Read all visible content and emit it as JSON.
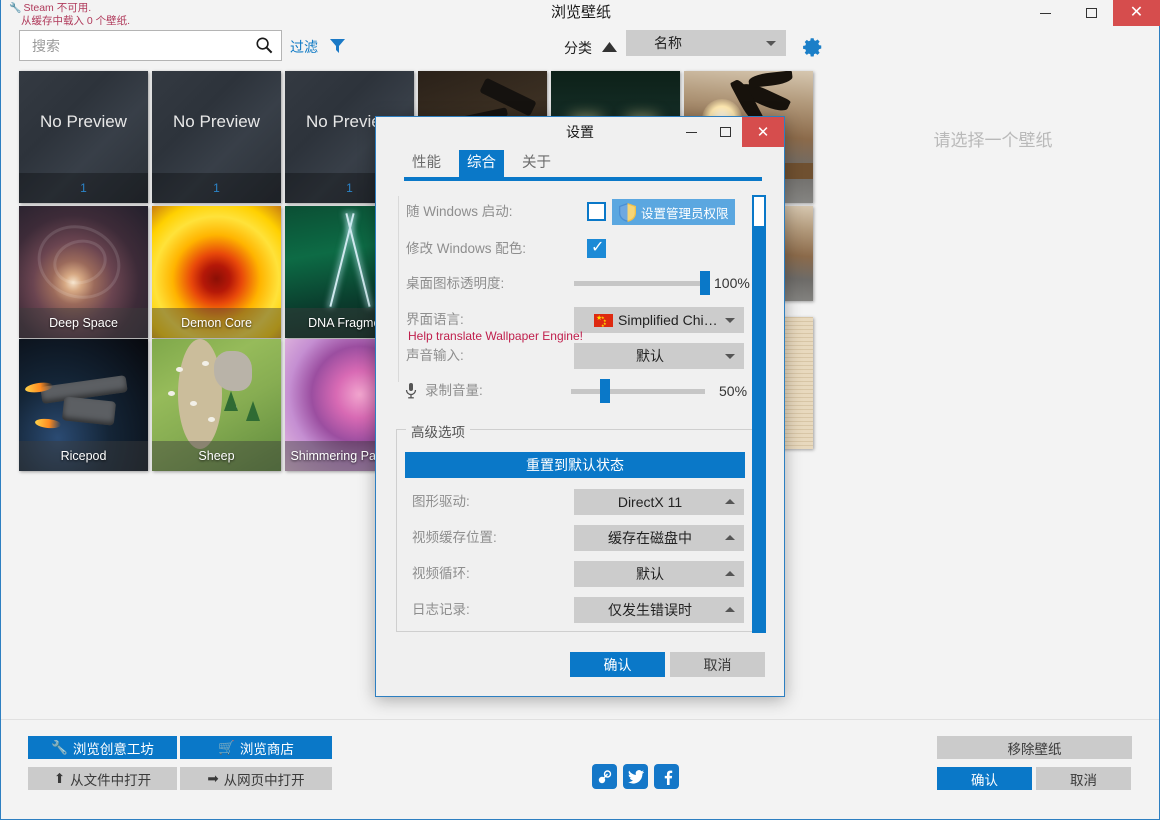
{
  "window": {
    "title": "浏览壁纸",
    "minimize_icon": "minimize-icon",
    "maximize_icon": "maximize-icon",
    "close_icon": "close-icon",
    "close_glyph": "✕"
  },
  "status": {
    "line1": "Steam 不可用.",
    "line2": "从缓存中载入 0 个壁纸."
  },
  "search": {
    "placeholder": "搜索",
    "value": "",
    "icon": "search-icon"
  },
  "filter": {
    "label": "过滤",
    "icon": "funnel-icon"
  },
  "sort": {
    "label": "分类",
    "direction_icon": "sort-ascending-icon",
    "selected": "名称"
  },
  "settings_gear": {
    "icon": "gear-icon"
  },
  "grid": {
    "tiles": [
      {
        "title": "No Preview",
        "count": "1",
        "style": "bg-np",
        "kind": "nopreview"
      },
      {
        "title": "No Preview",
        "count": "1",
        "style": "bg-np",
        "kind": "nopreview"
      },
      {
        "title": "No Preview",
        "count": "1",
        "style": "bg-np",
        "kind": "nopreview"
      },
      {
        "title": "",
        "count": "",
        "style": "bg-gun",
        "kind": "image"
      },
      {
        "title": "",
        "count": "",
        "style": "bg-lanterns",
        "kind": "image"
      },
      {
        "title": "",
        "count": "",
        "style": "bg-palm",
        "kind": "image"
      },
      {
        "title": "Deep Space",
        "count": "",
        "style": "bg-deepspace",
        "kind": "image"
      },
      {
        "title": "Demon Core",
        "count": "",
        "style": "bg-demoncore",
        "kind": "image"
      },
      {
        "title": "DNA Fragment",
        "count": "",
        "style": "bg-dna",
        "kind": "image"
      },
      {
        "title": "Ricepod",
        "count": "",
        "style": "bg-ricepod",
        "kind": "image"
      },
      {
        "title": "Sheep",
        "count": "",
        "style": "bg-sheep",
        "kind": "image"
      },
      {
        "title": "Shimmering Particles",
        "count": "",
        "style": "bg-shimmer",
        "kind": "image"
      },
      {
        "title": "",
        "count": "",
        "style": "bg-grid-paper",
        "kind": "image"
      }
    ]
  },
  "preview_pane": {
    "hint": "请选择一个壁纸"
  },
  "bottom_toolbar": {
    "browse_workshop": "浏览创意工坊",
    "browse_workshop_icon": "wrench-icon",
    "browse_store": "浏览商店",
    "browse_store_icon": "cart-icon",
    "open_from_file": "从文件中打开",
    "open_from_file_icon": "upload-icon",
    "open_from_web": "从网页中打开",
    "open_from_web_icon": "arrow-icon",
    "remove_wallpaper": "移除壁纸",
    "ok": "确认",
    "cancel": "取消",
    "social": [
      {
        "name": "steam-icon",
        "glyph": "☍"
      },
      {
        "name": "twitter-icon",
        "glyph": "🐦"
      },
      {
        "name": "facebook-icon",
        "glyph": "f"
      }
    ]
  },
  "settings_dialog": {
    "title": "设置",
    "close_glyph": "✕",
    "tabs": [
      {
        "label": "性能",
        "active": false
      },
      {
        "label": "综合",
        "active": true
      },
      {
        "label": "关于",
        "active": false
      }
    ],
    "general": {
      "start_with_windows": {
        "label": "随 Windows 启动:",
        "checked": false
      },
      "admin_button": {
        "label": "设置管理员权限",
        "icon": "shield-icon"
      },
      "modify_windows_color": {
        "label": "修改 Windows 配色:",
        "checked": true
      },
      "desktop_icon_opacity": {
        "label": "桌面图标透明度:",
        "value": "100%",
        "percent": 100
      },
      "interface_language": {
        "label": "界面语言:",
        "value": "Simplified Chi…",
        "flag": "china-flag-icon"
      },
      "help_translate": "Help translate Wallpaper Engine!",
      "audio_input": {
        "label": "声音输入:",
        "value": "默认"
      },
      "recording_volume": {
        "label": "录制音量:",
        "icon": "microphone-icon",
        "value": "50%",
        "percent": 50
      }
    },
    "advanced": {
      "legend": "高级选项",
      "reset_button": "重置到默认状态",
      "graphics_driver": {
        "label": "图形驱动:",
        "value": "DirectX 11"
      },
      "video_cache_location": {
        "label": "视频缓存位置:",
        "value": "缓存在磁盘中"
      },
      "video_loop": {
        "label": "视频循环:",
        "value": "默认"
      },
      "logging": {
        "label": "日志记录:",
        "value": "仅发生错误时"
      }
    },
    "footer": {
      "ok": "确认",
      "cancel": "取消"
    },
    "scrollbar": {
      "name": "dialog-scrollbar"
    }
  },
  "colors": {
    "accent_blue": "#0a78c8",
    "close_red": "#d64d4d",
    "dropdown_grey": "#cccccc",
    "button_grey": "#cbcbcb",
    "translate_red": "#c0204d",
    "status_red": "#b03a5b"
  }
}
